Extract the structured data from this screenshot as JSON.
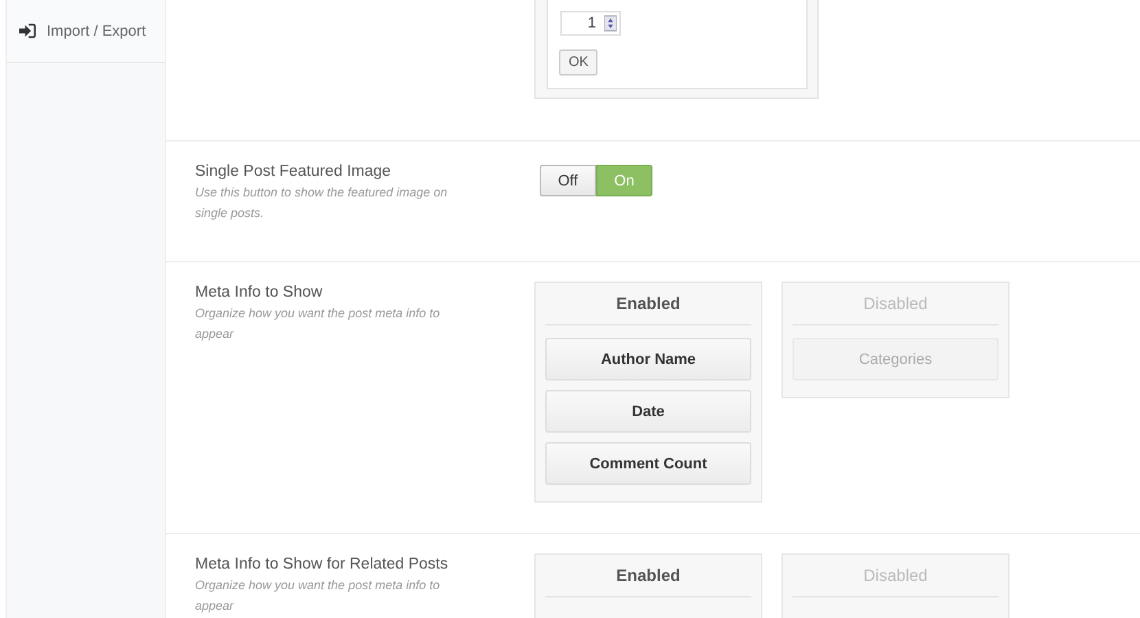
{
  "sidebar": {
    "items": [
      {
        "label": "Import / Export",
        "selected": false
      }
    ]
  },
  "top_option": {
    "spinner_value": "1",
    "ok_button": "OK"
  },
  "sections": [
    {
      "kind": "toggle",
      "title": "Single Post Featured Image",
      "description": "Use this button to show the featured image on single posts.",
      "options": [
        {
          "label": "Off",
          "selected": false
        },
        {
          "label": "On",
          "selected": true
        }
      ]
    },
    {
      "kind": "sorter",
      "title": "Meta Info to Show",
      "description": "Organize how you want the post meta info to appear",
      "columns": [
        {
          "title": "Enabled",
          "enabled": true,
          "items": [
            "Author Name",
            "Date",
            "Comment Count"
          ]
        },
        {
          "title": "Disabled",
          "enabled": false,
          "items": [
            "Categories"
          ]
        }
      ]
    },
    {
      "kind": "sorter",
      "title": "Meta Info to Show for Related Posts",
      "description": "Organize how you want the post meta info to appear",
      "columns": [
        {
          "title": "Enabled",
          "enabled": true
        },
        {
          "title": "Disabled",
          "enabled": false
        }
      ]
    }
  ]
}
